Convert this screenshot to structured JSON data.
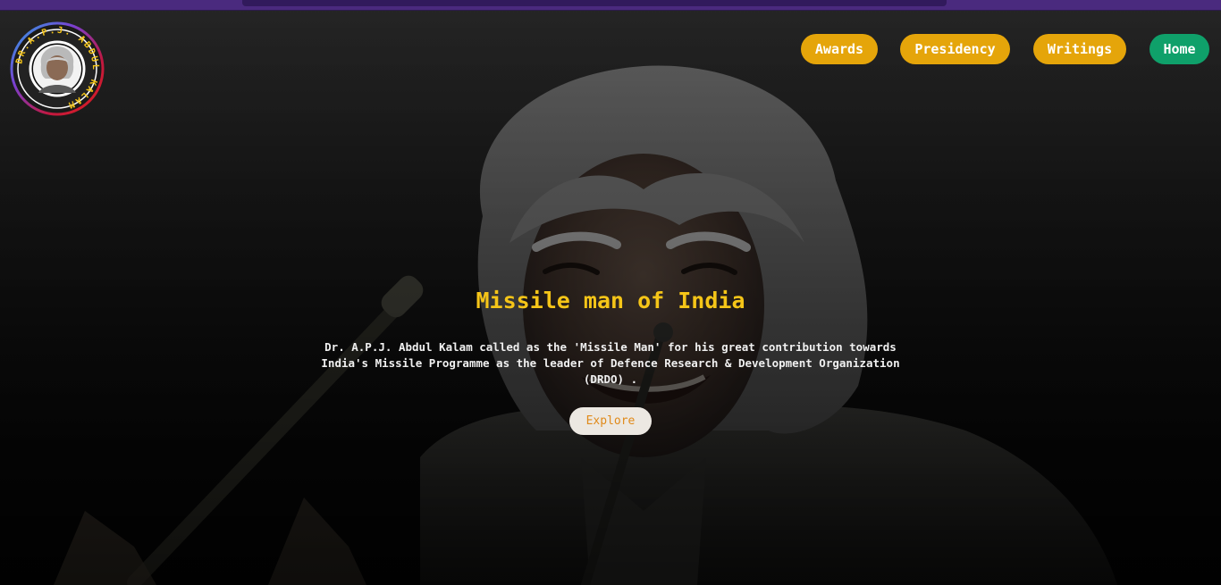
{
  "logo": {
    "ring_text": "DR.A.P.J. ABDUL KALAM",
    "portrait_alt": "Dr. A.P.J. Abdul Kalam"
  },
  "nav": {
    "items": [
      {
        "label": "Awards"
      },
      {
        "label": "Presidency"
      },
      {
        "label": "Writings"
      },
      {
        "label": "Home"
      }
    ]
  },
  "hero": {
    "title": "Missile man of India",
    "description": "Dr. A.P.J. Abdul Kalam called as the 'Missile Man' for his great contribution towards India's Missile Programme as the leader of Defence Research & Development Organization (DRDO) .",
    "cta_label": "Explore"
  },
  "colors": {
    "accent_gold": "#e5a50a",
    "title_yellow": "#f5c518",
    "home_green": "#0fa06a",
    "top_strip_purple": "#4a2a7e",
    "explore_text": "#e08a1a"
  },
  "icons": {
    "logo": "portrait-logo-icon"
  }
}
